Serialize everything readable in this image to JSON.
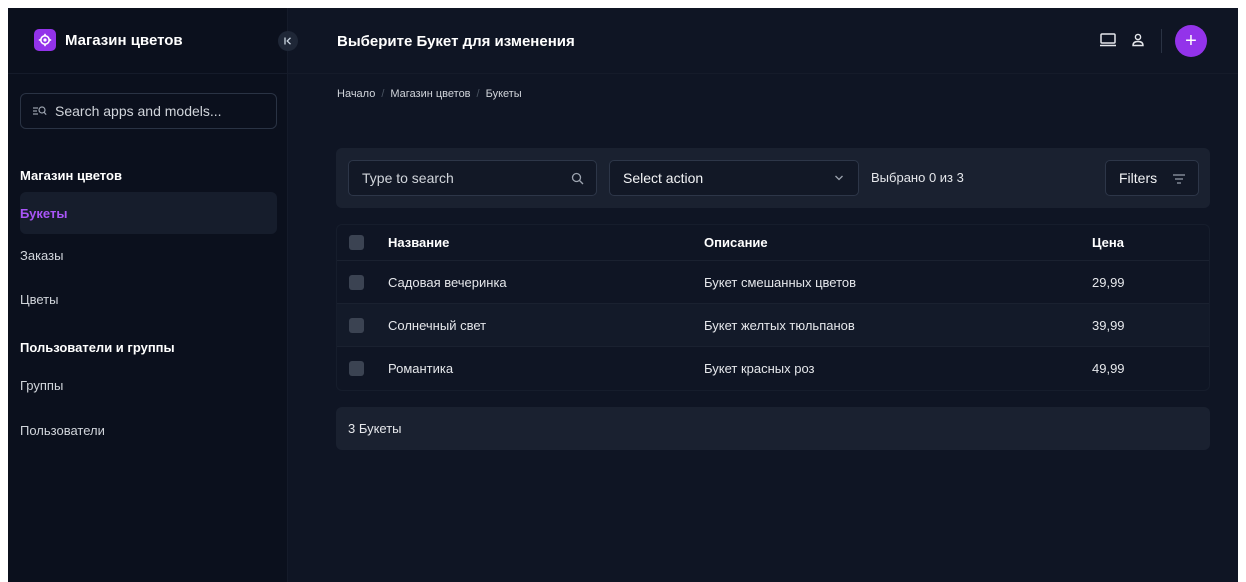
{
  "brand": {
    "title": "Магазин цветов",
    "logo_icon": "gear-icon",
    "accent": "#9333ea"
  },
  "search_apps": {
    "placeholder": "Search apps and models..."
  },
  "sidebar": {
    "sections": [
      {
        "heading": "Магазин цветов",
        "items": [
          {
            "label": "Букеты",
            "active": true
          },
          {
            "label": "Заказы",
            "active": false
          },
          {
            "label": "Цветы",
            "active": false
          }
        ]
      },
      {
        "heading": "Пользователи и группы",
        "items": [
          {
            "label": "Группы",
            "active": false
          },
          {
            "label": "Пользователи",
            "active": false
          }
        ]
      }
    ]
  },
  "header": {
    "title": "Выберите Букет для изменения",
    "add_label": "+"
  },
  "breadcrumb": [
    "Начало",
    "Магазин цветов",
    "Букеты"
  ],
  "toolbar": {
    "search_placeholder": "Type to search",
    "action_label": "Select action",
    "selected_count": "Выбрано 0 из 3",
    "filters_label": "Filters"
  },
  "table": {
    "columns": [
      "Название",
      "Описание",
      "Цена"
    ],
    "rows": [
      [
        "Садовая вечеринка",
        "Букет смешанных цветов",
        "29,99"
      ],
      [
        "Солнечный свет",
        "Букет желтых тюльпанов",
        "39,99"
      ],
      [
        "Романтика",
        "Букет красных роз",
        "49,99"
      ]
    ]
  },
  "footer": {
    "count_text": "3 Букеты"
  }
}
